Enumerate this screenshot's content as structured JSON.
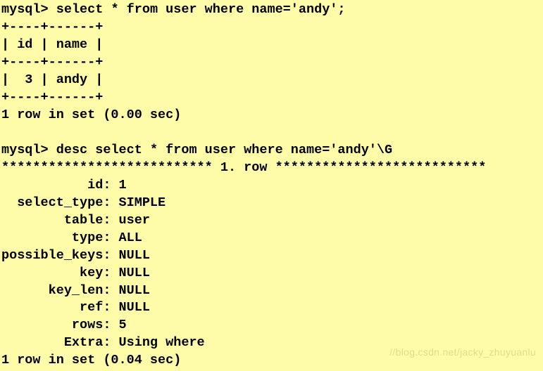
{
  "prompt": "mysql>",
  "query1": {
    "sql": "select * from user where name='andy';",
    "table": {
      "divider": "+----+------+",
      "header": "| id | name |",
      "row1": "|  3 | andy |"
    },
    "result_msg": "1 row in set (0.00 sec)"
  },
  "query2": {
    "sql": "desc select * from user where name='andy'\\G",
    "banner": "*************************** 1. row ***************************",
    "fields": {
      "id": "           id: 1",
      "select_type": "  select_type: SIMPLE",
      "table": "        table: user",
      "type": "         type: ALL",
      "possible_keys": "possible_keys: NULL",
      "key": "          key: NULL",
      "key_len": "      key_len: NULL",
      "ref": "          ref: NULL",
      "rows": "         rows: 5",
      "extra": "        Extra: Using where"
    },
    "result_msg": "1 row in set (0.04 sec)"
  },
  "chart_data": {
    "type": "table",
    "query1_result": {
      "columns": [
        "id",
        "name"
      ],
      "rows": [
        [
          3,
          "andy"
        ]
      ],
      "summary": "1 row in set (0.00 sec)"
    },
    "query2_explain": {
      "row_number": 1,
      "id": 1,
      "select_type": "SIMPLE",
      "table": "user",
      "type": "ALL",
      "possible_keys": null,
      "key": null,
      "key_len": null,
      "ref": null,
      "rows": 5,
      "Extra": "Using where",
      "summary": "1 row in set (0.04 sec)"
    }
  },
  "watermark": "//blog.csdn.net/jacky_zhuyuanlu"
}
